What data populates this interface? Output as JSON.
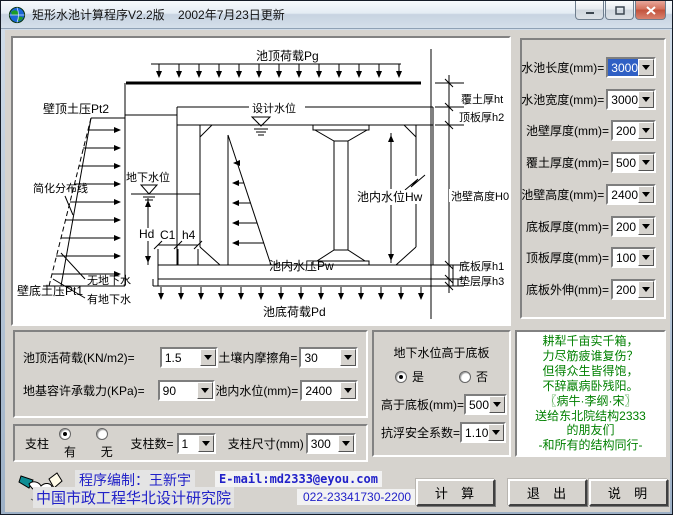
{
  "window": {
    "title": "矩形水池计算程序V2.2版    2002年7月23日更新"
  },
  "diagram": {
    "top_load": "池顶荷载Pg",
    "wall_top_pressure": "壁顶土压Pt2",
    "simplified_line": "简化分布线",
    "design_water_level": "设计水位",
    "ground_water_level": "地下水位",
    "inner_water_level": "池内水位Hw",
    "inner_water_pressure": "池内水压Pw",
    "wall_bottom_pressure": "壁底土压Pt1",
    "no_groundwater": "无地下水",
    "with_groundwater": "有地下水",
    "dim_hd": "Hd",
    "dim_c1": "C1",
    "dim_h4": "h4",
    "bottom_load": "池底荷载Pd",
    "dim_cover": "覆土厚ht",
    "dim_top_slab": "顶板厚h2",
    "dim_wall_height": "池壁高度H0",
    "dim_base_slab": "底板厚h1",
    "dim_cushion": "垫层厚h3"
  },
  "right_panel": {
    "fields": [
      {
        "label": "水池长度(mm)=",
        "value": "3000"
      },
      {
        "label": "水池宽度(mm)=",
        "value": "3000"
      },
      {
        "label": "池壁厚度(mm)=",
        "value": "200"
      },
      {
        "label": "覆土厚度(mm)=",
        "value": "500"
      },
      {
        "label": "池壁高度(mm)=",
        "value": "2400"
      },
      {
        "label": "底板厚度(mm)=",
        "value": "200"
      },
      {
        "label": "顶板厚度(mm)=",
        "value": "100"
      },
      {
        "label": "底板外伸(mm)=",
        "value": "200"
      }
    ]
  },
  "loads_panel": {
    "rows": [
      {
        "label_left": "池顶活荷载(KN/m2)=",
        "value_left": "1.5",
        "label_right": "土壤内摩擦角=",
        "value_right": "30"
      },
      {
        "label_left": "地基容许承载力(KPa)=",
        "value_left": "90",
        "label_right": "池内水位(mm)=",
        "value_right": "2400"
      }
    ]
  },
  "groundwater_panel": {
    "title": "地下水位高于底板",
    "option_yes": "是",
    "option_no": "否",
    "selected": "是",
    "level_label": "高于底板(mm)=",
    "level_value": "500",
    "factor_label": "抗浮安全系数=",
    "factor_value": "1.10"
  },
  "pillar_panel": {
    "label": "支柱",
    "option_yes": "有",
    "option_no": "无",
    "selected": "有",
    "count_label": "支柱数=",
    "count_value": "1",
    "size_label": "支柱尺寸(mm)",
    "size_value": "300"
  },
  "poem": {
    "lines": [
      "耕犁千亩实千箱，",
      "力尽筋疲谁复伤？",
      "但得众生皆得饱，",
      "不辞羸病卧残阳。",
      "〖病牛·李纲·宋〗",
      "送给东北院结构2333",
      "的朋友们",
      "-和所有的结构同行-"
    ]
  },
  "credits": {
    "author": "程序编制：王新宇",
    "email": "E-mail:md2333@eyou.com",
    "org": "中国市政工程华北设计研究院",
    "phone": "022-23341730-2200"
  },
  "buttons": {
    "calculate": "计  算",
    "exit": "退  出",
    "help": "说  明"
  },
  "colors": {
    "selection_blue": "#2f5fc4",
    "poem_green": "#008000",
    "credit_blue": "#2121c8",
    "close_red": "#c2523c"
  }
}
